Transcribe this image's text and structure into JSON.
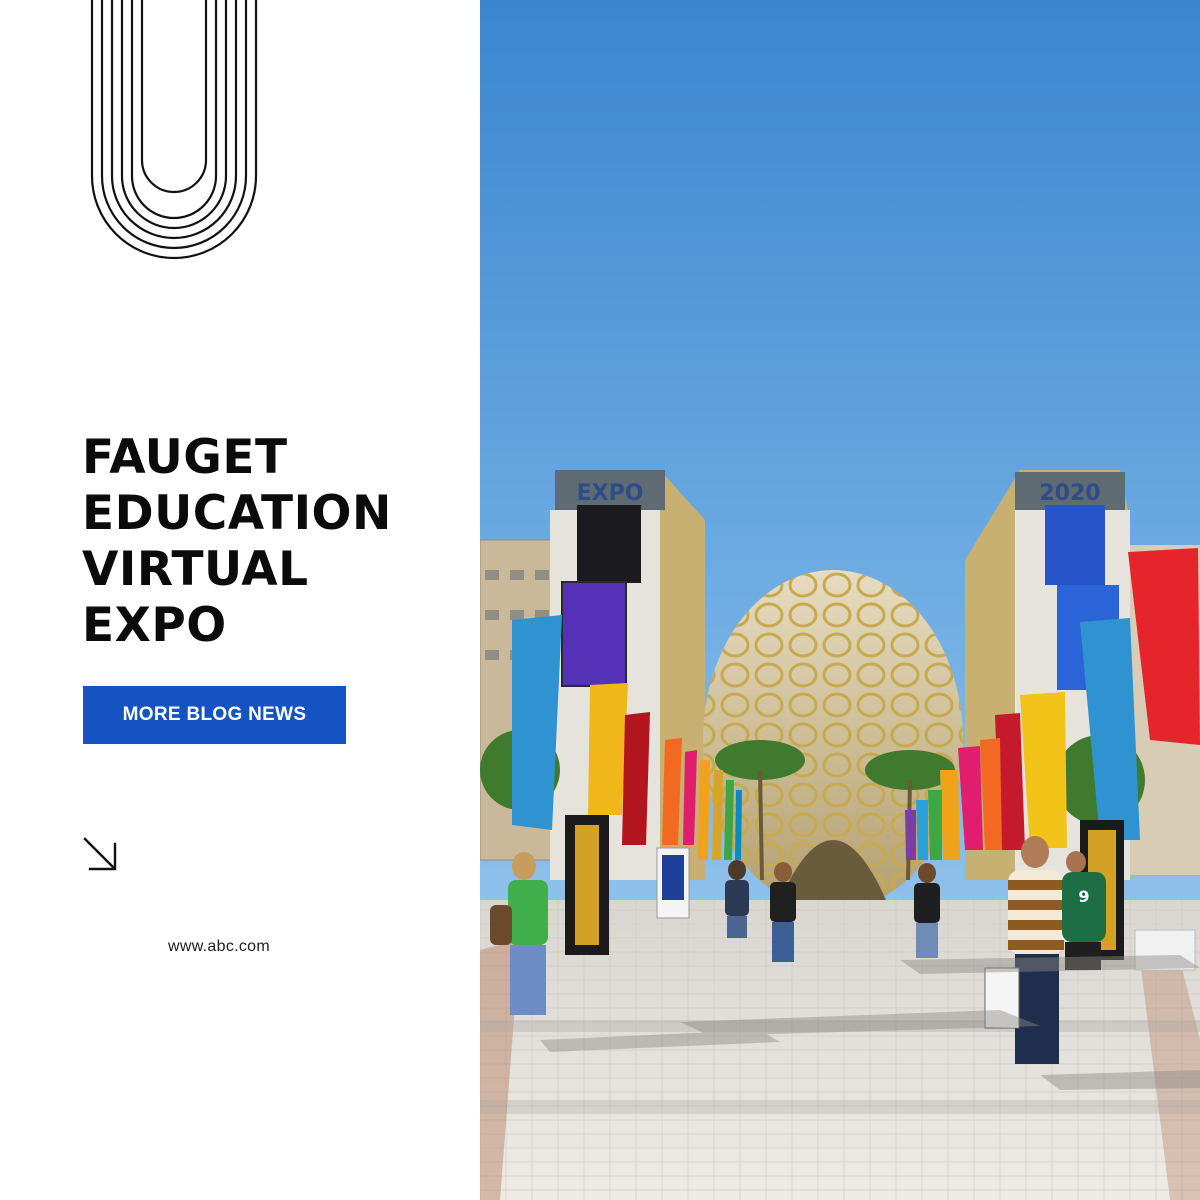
{
  "headline": {
    "line1": "FAUGET",
    "line2": "EDUCATION",
    "line3": "VIRTUAL",
    "line4": "EXPO"
  },
  "cta": {
    "label": "MORE BLOG NEWS"
  },
  "website": "www.abc.com",
  "photo": {
    "tower_left_sign": "EXPO",
    "tower_right_sign": "2020"
  },
  "icons": {
    "logo": "arch-lines-icon",
    "arrow": "arrow-down-right-icon"
  },
  "colors": {
    "accent": "#1553c2",
    "headline": "#0b0b0b",
    "sky": "#4f93d6"
  }
}
